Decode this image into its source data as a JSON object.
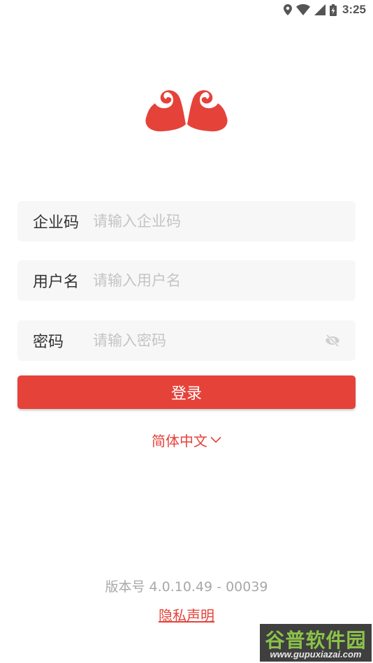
{
  "status_bar": {
    "time": "3:25",
    "icons": [
      "location-icon",
      "wifi-icon",
      "cell-signal-icon",
      "battery-charging-icon"
    ]
  },
  "logo": {
    "icon": "auspicious-cloud-logo",
    "color": "#e5423a"
  },
  "form": {
    "company_code": {
      "label": "企业码",
      "placeholder": "请输入企业码",
      "value": ""
    },
    "username": {
      "label": "用户名",
      "placeholder": "请输入用户名",
      "value": ""
    },
    "password": {
      "label": "密码",
      "placeholder": "请输入密码",
      "value": "",
      "toggle_icon": "eye-off-icon"
    }
  },
  "login_button": {
    "label": "登录"
  },
  "language": {
    "selected": "简体中文",
    "icon": "chevron-down-icon"
  },
  "footer": {
    "version": "版本号 4.0.10.49 - 00039",
    "privacy": "隐私声明"
  },
  "watermark": {
    "title": "谷普软件园",
    "url": "www.gupuxiazai.com"
  },
  "colors": {
    "accent": "#e5423a",
    "field_background": "#f7f7f7",
    "placeholder": "#c4c4c4",
    "version_text": "#a8a8a8"
  }
}
